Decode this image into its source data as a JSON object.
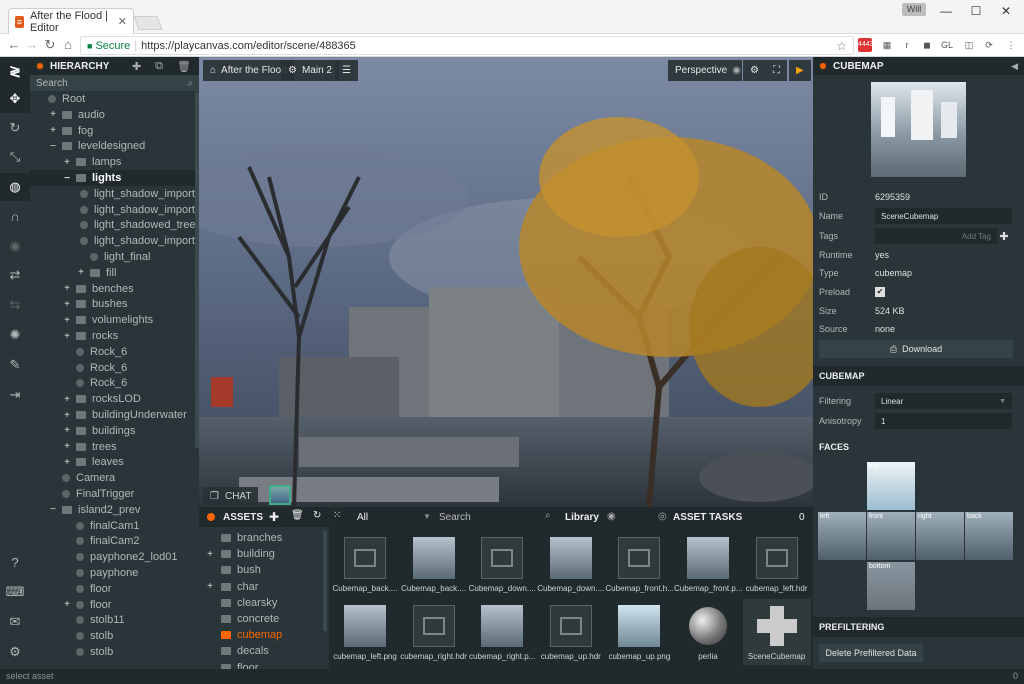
{
  "browser": {
    "tab_title": "After the Flood | Editor",
    "tab_favicon": "playcanvas-icon",
    "user_badge": "Will",
    "secure_label": "Secure",
    "url": "https://playcanvas.com/editor/scene/488365",
    "gmail_count": "4443",
    "ext_labels": [
      "r",
      "GL"
    ]
  },
  "toolbar": {
    "tools": [
      "playcanvas-logo-icon",
      "move-icon",
      "rotate-icon",
      "scale-icon",
      "world-icon",
      "magnet-icon",
      "eye-icon",
      "camera-icon",
      "snap-icon",
      "light-icon",
      "edit-icon",
      "publish-icon",
      "help-icon",
      "keyboard-icon",
      "chat-icon",
      "settings-icon"
    ]
  },
  "hierarchy": {
    "title": "HIERARCHY",
    "search_placeholder": "Search",
    "nodes": [
      {
        "label": "Root",
        "depth": 0,
        "pm": "",
        "type": "entity"
      },
      {
        "label": "audio",
        "depth": 1,
        "pm": "+",
        "type": "folder"
      },
      {
        "label": "fog",
        "depth": 1,
        "pm": "+",
        "type": "folder"
      },
      {
        "label": "leveldesigned",
        "depth": 1,
        "pm": "−",
        "type": "folder"
      },
      {
        "label": "lamps",
        "depth": 2,
        "pm": "+",
        "type": "folder"
      },
      {
        "label": "lights",
        "depth": 2,
        "pm": "−",
        "type": "folder",
        "selected": true
      },
      {
        "label": "light_shadow_important",
        "depth": 3,
        "pm": "",
        "type": "entity"
      },
      {
        "label": "light_shadow_important",
        "depth": 3,
        "pm": "",
        "type": "entity"
      },
      {
        "label": "light_shadowed_tree",
        "depth": 3,
        "pm": "",
        "type": "entity"
      },
      {
        "label": "light_shadow_important",
        "depth": 3,
        "pm": "",
        "type": "entity"
      },
      {
        "label": "light_final",
        "depth": 3,
        "pm": "",
        "type": "entity"
      },
      {
        "label": "fill",
        "depth": 3,
        "pm": "+",
        "type": "folder"
      },
      {
        "label": "benches",
        "depth": 2,
        "pm": "+",
        "type": "folder"
      },
      {
        "label": "bushes",
        "depth": 2,
        "pm": "+",
        "type": "folder"
      },
      {
        "label": "volumelights",
        "depth": 2,
        "pm": "+",
        "type": "folder"
      },
      {
        "label": "rocks",
        "depth": 2,
        "pm": "+",
        "type": "folder"
      },
      {
        "label": "Rock_6",
        "depth": 2,
        "pm": "",
        "type": "entity"
      },
      {
        "label": "Rock_6",
        "depth": 2,
        "pm": "",
        "type": "entity"
      },
      {
        "label": "Rock_6",
        "depth": 2,
        "pm": "",
        "type": "entity"
      },
      {
        "label": "rocksLOD",
        "depth": 2,
        "pm": "+",
        "type": "folder"
      },
      {
        "label": "buildingUnderwater",
        "depth": 2,
        "pm": "+",
        "type": "folder"
      },
      {
        "label": "buildings",
        "depth": 2,
        "pm": "+",
        "type": "folder"
      },
      {
        "label": "trees",
        "depth": 2,
        "pm": "+",
        "type": "folder"
      },
      {
        "label": "leaves",
        "depth": 2,
        "pm": "+",
        "type": "folder"
      },
      {
        "label": "Camera",
        "depth": 1,
        "pm": "",
        "type": "entity"
      },
      {
        "label": "FinalTrigger",
        "depth": 1,
        "pm": "",
        "type": "entity"
      },
      {
        "label": "island2_prev",
        "depth": 1,
        "pm": "−",
        "type": "folder"
      },
      {
        "label": "finalCam1",
        "depth": 2,
        "pm": "",
        "type": "entity"
      },
      {
        "label": "finalCam2",
        "depth": 2,
        "pm": "",
        "type": "entity"
      },
      {
        "label": "payphone2_lod01",
        "depth": 2,
        "pm": "",
        "type": "entity"
      },
      {
        "label": "payphone",
        "depth": 2,
        "pm": "",
        "type": "entity"
      },
      {
        "label": "floor",
        "depth": 2,
        "pm": "",
        "type": "entity"
      },
      {
        "label": "floor",
        "depth": 2,
        "pm": "+",
        "type": "entity"
      },
      {
        "label": "stolb11",
        "depth": 2,
        "pm": "",
        "type": "entity"
      },
      {
        "label": "stolb",
        "depth": 2,
        "pm": "",
        "type": "entity"
      },
      {
        "label": "stolb",
        "depth": 2,
        "pm": "",
        "type": "entity"
      }
    ]
  },
  "viewport": {
    "breadcrumb_project": "After the Flood",
    "breadcrumb_scene": "Main 2",
    "camera": "Perspective",
    "chat_label": "CHAT"
  },
  "assets": {
    "title": "ASSETS",
    "filter": "All",
    "search_placeholder": "Search",
    "library_label": "Library",
    "tasks_label": "ASSET TASKS",
    "tasks_count": "0",
    "folders": [
      {
        "label": "branches",
        "pm": ""
      },
      {
        "label": "building",
        "pm": "+"
      },
      {
        "label": "bush",
        "pm": ""
      },
      {
        "label": "char",
        "pm": "+"
      },
      {
        "label": "clearsky",
        "pm": ""
      },
      {
        "label": "concrete",
        "pm": ""
      },
      {
        "label": "cubemap",
        "pm": "",
        "selected": true
      },
      {
        "label": "decals",
        "pm": ""
      },
      {
        "label": "floor",
        "pm": ""
      }
    ],
    "items": [
      {
        "name": "Cubemap_back....",
        "thumb": "ph"
      },
      {
        "name": "Cubemap_back....",
        "thumb": "img"
      },
      {
        "name": "Cubemap_down....",
        "thumb": "ph"
      },
      {
        "name": "Cubemap_down....",
        "thumb": "img"
      },
      {
        "name": "Cubemap_front.h...",
        "thumb": "ph"
      },
      {
        "name": "Cubemap_front.p...",
        "thumb": "img"
      },
      {
        "name": "cubemap_left.hdr",
        "thumb": "ph"
      },
      {
        "name": "cubemap_left.png",
        "thumb": "img"
      },
      {
        "name": "cubemap_right.hdr",
        "thumb": "ph"
      },
      {
        "name": "cubemap_right.p...",
        "thumb": "img"
      },
      {
        "name": "cubemap_up.hdr",
        "thumb": "ph"
      },
      {
        "name": "cubemap_up.png",
        "thumb": "lite"
      },
      {
        "name": "perlia",
        "thumb": "sph"
      },
      {
        "name": "SceneCubemap",
        "thumb": "cross",
        "selected": true
      }
    ]
  },
  "inspector": {
    "title": "CUBEMAP",
    "id_label": "ID",
    "id_value": "6295359",
    "name_label": "Name",
    "name_value": "SceneCubemap",
    "tags_label": "Tags",
    "tags_placeholder": "Add Tag",
    "runtime_label": "Runtime",
    "runtime_value": "yes",
    "type_label": "Type",
    "type_value": "cubemap",
    "preload_label": "Preload",
    "preload_checked": "✔",
    "size_label": "Size",
    "size_value": "524 KB",
    "source_label": "Source",
    "source_value": "none",
    "download_label": "Download",
    "cubemap_section": "CUBEMAP",
    "filtering_label": "Filtering",
    "filtering_value": "Linear",
    "anisotropy_label": "Anisotropy",
    "anisotropy_value": "1",
    "faces_section": "FACES",
    "faces": {
      "top": "top",
      "left": "left",
      "front": "front",
      "right": "right",
      "back": "back",
      "bottom": "bottom"
    },
    "prefiltering_section": "PREFILTERING",
    "delete_prefiltered_label": "Delete Prefiltered Data"
  },
  "status": {
    "text": "select asset",
    "count": "0"
  }
}
